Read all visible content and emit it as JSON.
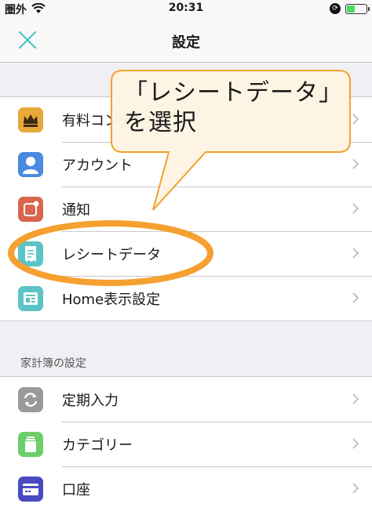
{
  "status_bar": {
    "carrier": "圏外",
    "time": "20:31"
  },
  "nav": {
    "title": "設定"
  },
  "group1": {
    "items": [
      {
        "label": "有料コンテンツ",
        "icon": "crown-icon",
        "color": "#e8a83a"
      },
      {
        "label": "アカウント",
        "icon": "person-icon",
        "color": "#4a8ae0"
      },
      {
        "label": "通知",
        "icon": "notification-icon",
        "color": "#d8654f"
      },
      {
        "label": "レシートデータ",
        "icon": "receipt-icon",
        "color": "#5cc4c4"
      },
      {
        "label": "Home表示設定",
        "icon": "home-layout-icon",
        "color": "#5cc4c4"
      }
    ]
  },
  "section2": {
    "header": "家計簿の設定"
  },
  "group2": {
    "items": [
      {
        "label": "定期入力",
        "icon": "recurring-icon",
        "color": "#9a9a9a"
      },
      {
        "label": "カテゴリー",
        "icon": "category-icon",
        "color": "#6ccf6c"
      },
      {
        "label": "口座",
        "icon": "account-card-icon",
        "color": "#4a4ac0"
      }
    ]
  },
  "annotation": {
    "line1": "「レシートデータ」",
    "line2": "を選択",
    "accent": "#f5a030",
    "fill": "#fdf3e2"
  }
}
